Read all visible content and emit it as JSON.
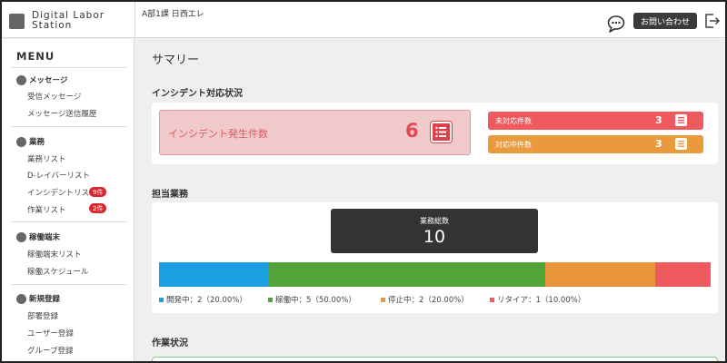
{
  "header": {
    "logo_line1": "Digital Labor",
    "logo_line2": "Station",
    "user_info": "A部1課 日西エレ",
    "contact_label": "お問い合わせ"
  },
  "sidebar": {
    "title": "MENU",
    "sections": [
      {
        "label": "メッセージ",
        "items": [
          {
            "label": "受信メッセージ"
          },
          {
            "label": "メッセージ送信履歴"
          }
        ]
      },
      {
        "label": "業務",
        "items": [
          {
            "label": "業務リスト"
          },
          {
            "label": "D-レイバーリスト"
          },
          {
            "label": "インシデントリスト",
            "badge": "9件"
          },
          {
            "label": "作業リスト",
            "badge": "2件"
          }
        ]
      },
      {
        "label": "稼働端末",
        "items": [
          {
            "label": "稼働端末リスト"
          },
          {
            "label": "稼働スケジュール"
          }
        ]
      },
      {
        "label": "新規登録",
        "items": [
          {
            "label": "部署登録"
          },
          {
            "label": "ユーザー登録"
          },
          {
            "label": "グループ登録"
          }
        ]
      }
    ]
  },
  "main": {
    "page_title": "サマリー",
    "incident": {
      "section_title": "インシデント対応状況",
      "label": "インシデント発生件数",
      "count": "6",
      "rows": [
        {
          "label": "未対応件数",
          "count": "3",
          "color": "#ee5a5d"
        },
        {
          "label": "対応中件数",
          "count": "3",
          "color": "#e89a3c"
        }
      ]
    },
    "tasks": {
      "section_title": "担当業務",
      "total_label": "業務総数",
      "total_value": "10",
      "segments": [
        {
          "label": "開発中：2（20.00%）",
          "value": 2,
          "color": "#1b9fe3"
        },
        {
          "label": "稼働中：5（50.00%）",
          "value": 5,
          "color": "#52a43a"
        },
        {
          "label": "停止中：2（20.00%）",
          "value": 2,
          "color": "#e8953c"
        },
        {
          "label": "リタイア：1（10.00%）",
          "value": 1,
          "color": "#ee5a5d"
        }
      ]
    },
    "work": {
      "section_title": "作業状況"
    }
  }
}
